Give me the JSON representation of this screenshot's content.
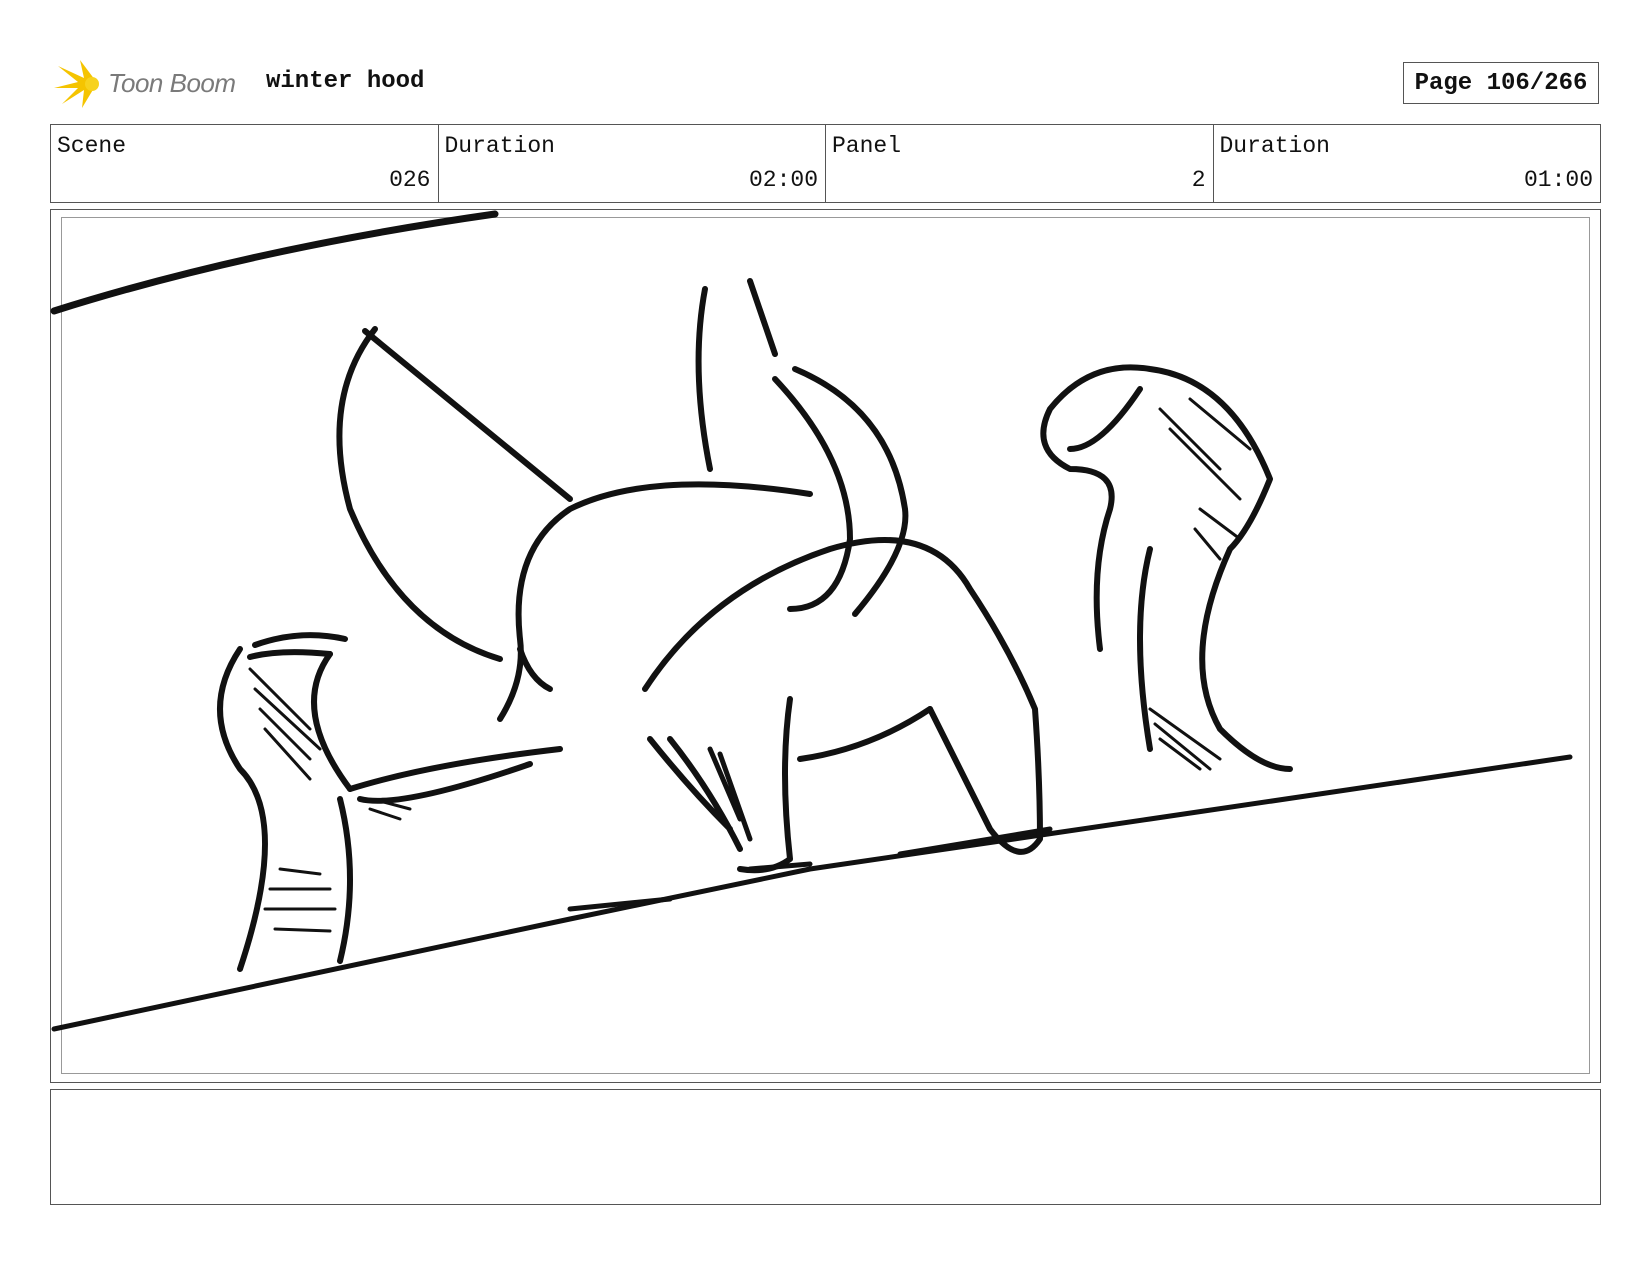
{
  "header": {
    "logo_text": "Toon Boom",
    "title": "winter hood",
    "page_label": "Page 106/266"
  },
  "info": {
    "scene_label": "Scene",
    "scene_value": "026",
    "scene_duration_label": "Duration",
    "scene_duration_value": "02:00",
    "panel_label": "Panel",
    "panel_value": "2",
    "panel_duration_label": "Duration",
    "panel_duration_value": "01:00"
  },
  "notes": {
    "text": ""
  },
  "colors": {
    "logo_burst": "#f5c400",
    "logo_text": "#7a7a7a",
    "border": "#555555"
  }
}
